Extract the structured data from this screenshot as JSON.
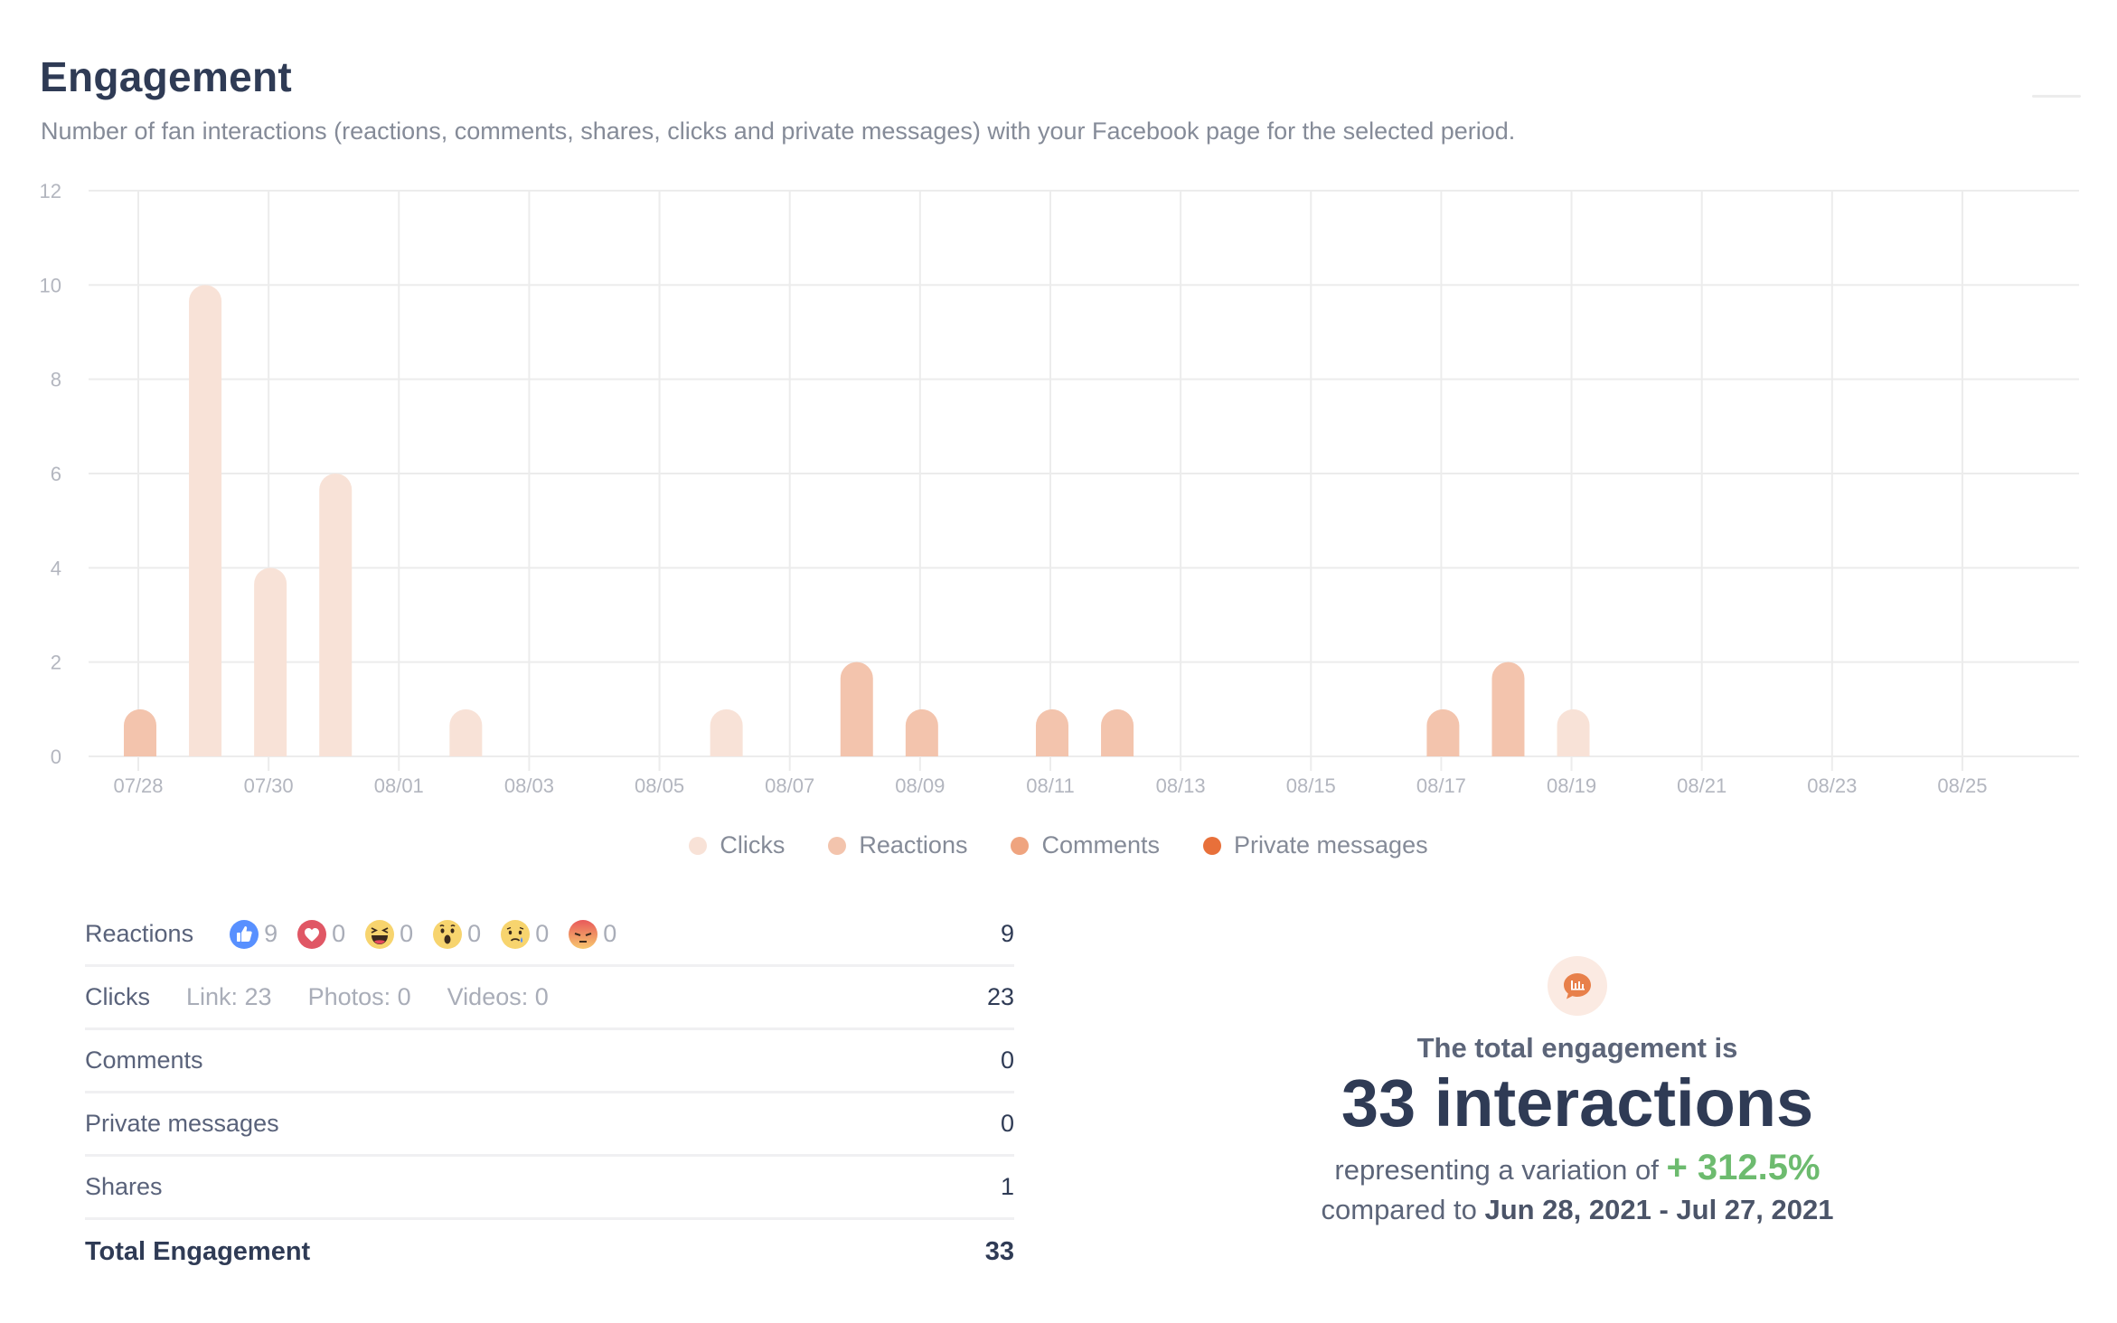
{
  "header": {
    "title": "Engagement",
    "subtitle": "Number of fan interactions (reactions, comments, shares, clicks and private messages) with your Facebook page for the selected period."
  },
  "colors": {
    "clicks": "#F8E2D7",
    "reactions": "#F3C4AD",
    "comments": "#EFA47F",
    "private_messages": "#E8703A",
    "variation_positive": "#6DBB6F",
    "title": "#2F3B55"
  },
  "chart_data": {
    "type": "bar",
    "stacked": true,
    "title": "Engagement",
    "xlabel": "",
    "ylabel": "",
    "ylim": [
      0,
      12
    ],
    "yticks": [
      "0",
      "2",
      "4",
      "6",
      "8",
      "10",
      "12"
    ],
    "grid": true,
    "legend_position": "bottom-center",
    "categories": [
      "07/28",
      "07/29",
      "07/30",
      "07/31",
      "08/01",
      "08/02",
      "08/03",
      "08/04",
      "08/05",
      "08/06",
      "08/07",
      "08/08",
      "08/09",
      "08/10",
      "08/11",
      "08/12",
      "08/13",
      "08/14",
      "08/15",
      "08/16",
      "08/17",
      "08/18",
      "08/19",
      "08/20",
      "08/21",
      "08/22",
      "08/23",
      "08/24",
      "08/25",
      "08/26"
    ],
    "xtick_labels": [
      "07/28",
      "07/30",
      "08/01",
      "08/03",
      "08/05",
      "08/07",
      "08/09",
      "08/11",
      "08/13",
      "08/15",
      "08/17",
      "08/19",
      "08/21",
      "08/23",
      "08/25"
    ],
    "series": [
      {
        "name": "Clicks",
        "color": "#F8E2D7",
        "values": [
          0,
          10,
          4,
          6,
          0,
          1,
          0,
          0,
          0,
          1,
          0,
          0,
          0,
          0,
          0,
          0,
          0,
          0,
          0,
          0,
          0,
          0,
          1,
          0,
          0,
          0,
          0,
          0,
          0,
          0
        ]
      },
      {
        "name": "Reactions",
        "color": "#F3C4AD",
        "values": [
          1,
          0,
          0,
          0,
          0,
          0,
          0,
          0,
          0,
          0,
          0,
          2,
          1,
          0,
          1,
          1,
          0,
          0,
          0,
          0,
          1,
          2,
          0,
          0,
          0,
          0,
          0,
          0,
          0,
          0
        ]
      },
      {
        "name": "Comments",
        "color": "#EFA47F",
        "values": [
          0,
          0,
          0,
          0,
          0,
          0,
          0,
          0,
          0,
          0,
          0,
          0,
          0,
          0,
          0,
          0,
          0,
          0,
          0,
          0,
          0,
          0,
          0,
          0,
          0,
          0,
          0,
          0,
          0,
          0
        ]
      },
      {
        "name": "Private messages",
        "color": "#E8703A",
        "values": [
          0,
          0,
          0,
          0,
          0,
          0,
          0,
          0,
          0,
          0,
          0,
          0,
          0,
          0,
          0,
          0,
          0,
          0,
          0,
          0,
          0,
          0,
          0,
          0,
          0,
          0,
          0,
          0,
          0,
          0
        ]
      }
    ]
  },
  "legend": [
    {
      "label": "Clicks",
      "color": "#F8E2D7"
    },
    {
      "label": "Reactions",
      "color": "#F3C4AD"
    },
    {
      "label": "Comments",
      "color": "#EFA47F"
    },
    {
      "label": "Private messages",
      "color": "#E8703A"
    }
  ],
  "breakdown": {
    "reactions": {
      "label": "Reactions",
      "value": "9",
      "types": [
        {
          "icon": "like-icon",
          "count": "9"
        },
        {
          "icon": "love-icon",
          "count": "0"
        },
        {
          "icon": "haha-icon",
          "count": "0"
        },
        {
          "icon": "wow-icon",
          "count": "0"
        },
        {
          "icon": "sad-icon",
          "count": "0"
        },
        {
          "icon": "angry-icon",
          "count": "0"
        }
      ]
    },
    "clicks": {
      "label": "Clicks",
      "value": "23",
      "link": "Link: 23",
      "photos": "Photos: 0",
      "videos": "Videos: 0"
    },
    "comments": {
      "label": "Comments",
      "value": "0"
    },
    "private_messages": {
      "label": "Private messages",
      "value": "0"
    },
    "shares": {
      "label": "Shares",
      "value": "1"
    },
    "total": {
      "label": "Total Engagement",
      "value": "33"
    }
  },
  "summary": {
    "icon": "chat-chart-icon",
    "lead": "The total engagement is",
    "big": "33 interactions",
    "variation_prefix": "representing a variation of",
    "variation": "+ 312.5%",
    "compared_prefix": "compared to",
    "compared_period": "Jun 28, 2021 - Jul 27, 2021"
  }
}
